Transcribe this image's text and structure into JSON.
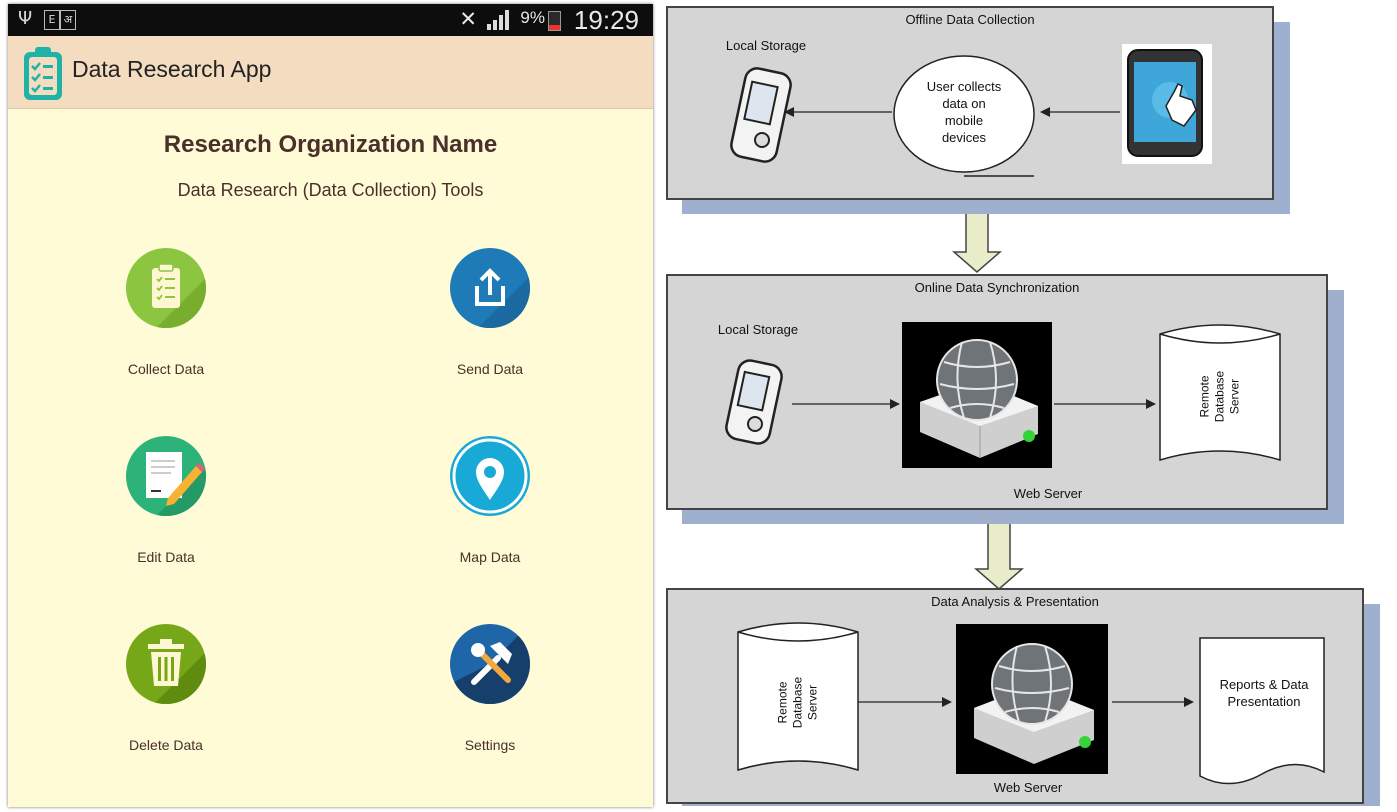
{
  "phone": {
    "status": {
      "battery": "9%",
      "time": "19:29",
      "box1": "E",
      "box2": "अ"
    },
    "app_title": "Data Research App",
    "org_name": "Research Organization Name",
    "org_subtitle": "Data Research (Data Collection) Tools",
    "tiles": [
      {
        "label": "Collect Data",
        "icon": "clipboard-icon",
        "color": "#8cc53f"
      },
      {
        "label": "Send Data",
        "icon": "upload-icon",
        "color": "#1f7ab8"
      },
      {
        "label": "Edit Data",
        "icon": "document-edit-icon",
        "color": "#2db27a"
      },
      {
        "label": "Map Data",
        "icon": "map-pin-icon",
        "color": "#19a9d6"
      },
      {
        "label": "Delete Data",
        "icon": "trash-icon",
        "color": "#76a718"
      },
      {
        "label": "Settings",
        "icon": "tools-icon",
        "color": "#1f66a8"
      }
    ],
    "colors": {
      "appbar": "#f3dcbf",
      "background": "#fffbd6",
      "text": "#4a2f2a"
    }
  },
  "diagram": {
    "panel1": {
      "title": "Offline Data Collection",
      "local_storage": "Local Storage",
      "user_collects": [
        "User collects",
        "data on",
        "mobile",
        "devices"
      ]
    },
    "panel2": {
      "title": "Online Data Synchronization",
      "local_storage": "Local Storage",
      "web_server": "Web Server",
      "remote_db": [
        "Remote",
        "Database",
        "Server"
      ]
    },
    "panel3": {
      "title": "Data Analysis & Presentation",
      "remote_db": [
        "Remote",
        "Database",
        "Server"
      ],
      "web_server": "Web Server",
      "reports": [
        "Reports & Data",
        "Presentation"
      ]
    },
    "colors": {
      "panel": "#d5d5d5",
      "shadow": "#9fb0cf",
      "connector": "#e9ecc8"
    }
  }
}
